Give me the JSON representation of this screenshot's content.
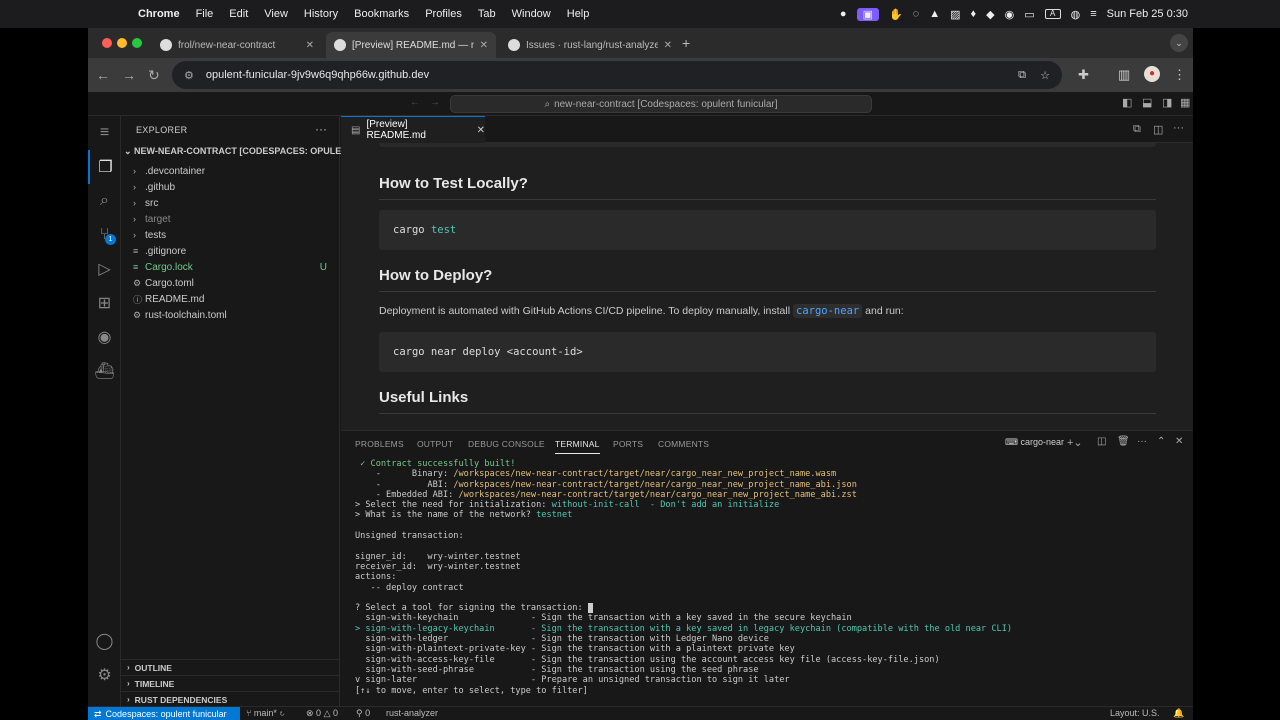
{
  "menubar": {
    "items": [
      "Chrome",
      "File",
      "Edit",
      "View",
      "History",
      "Bookmarks",
      "Profiles",
      "Tab",
      "Window",
      "Help"
    ],
    "datetime": "Sun Feb 25  0:30",
    "input_indicator": "A"
  },
  "browser": {
    "tabs": [
      {
        "label": "frol/new-near-contract"
      },
      {
        "label": "[Preview] README.md — new-near-contract"
      },
      {
        "label": "Issues · rust-lang/rust-analyzer"
      }
    ],
    "url": "opulent-funicular-9jv9w6q9qhp66w.github.dev"
  },
  "vscode": {
    "command_center": "new-near-contract [Codespaces: opulent funicular]",
    "explorer": {
      "title": "EXPLORER",
      "root": "NEW-NEAR-CONTRACT [CODESPACES: OPULE...",
      "items": [
        {
          "label": ".devcontainer",
          "type": "folder"
        },
        {
          "label": ".github",
          "type": "folder"
        },
        {
          "label": "src",
          "type": "folder"
        },
        {
          "label": "target",
          "type": "folder",
          "dim": true
        },
        {
          "label": "tests",
          "type": "folder"
        },
        {
          "label": ".gitignore",
          "type": "file"
        },
        {
          "label": "Cargo.lock",
          "type": "file",
          "status": "U"
        },
        {
          "label": "Cargo.toml",
          "type": "file"
        },
        {
          "label": "README.md",
          "type": "file"
        },
        {
          "label": "rust-toolchain.toml",
          "type": "file"
        }
      ],
      "sections": [
        "OUTLINE",
        "TIMELINE",
        "RUST DEPENDENCIES"
      ]
    },
    "editor_tab": "[Preview] README.md",
    "preview": {
      "heading_test": "How to Test Locally?",
      "code_test_cmd": "cargo",
      "code_test_arg": "test",
      "heading_deploy": "How to Deploy?",
      "deploy_text_before": "Deployment is automated with GitHub Actions CI/CD pipeline. To deploy manually, install",
      "deploy_code": "cargo-near",
      "deploy_text_after": "and run:",
      "code_deploy": "cargo near deploy <account-id>",
      "heading_links": "Useful Links"
    },
    "panel": {
      "tabs": [
        "PROBLEMS",
        "OUTPUT",
        "DEBUG CONSOLE",
        "TERMINAL",
        "PORTS",
        "COMMENTS"
      ],
      "active_tab": "TERMINAL",
      "terminal_name": "cargo-near",
      "terminal": {
        "built": " ✓ Contract successfully built!",
        "binary_label": "    -      Binary: ",
        "binary_path": "/workspaces/new-near-contract/target/near/cargo_near_new_project_name.wasm",
        "abi_label": "    -         ABI: ",
        "abi_path": "/workspaces/new-near-contract/target/near/cargo_near_new_project_name_abi.json",
        "emb_label": "    - Embedded ABI: ",
        "emb_path": "/workspaces/new-near-contract/target/near/cargo_near_new_project_name_abi.zst",
        "init_q": "> Select the need for initialization: ",
        "init_a": "without-init-call  - Don't add an initialize",
        "net_q": "> What is the name of the network? ",
        "net_a": "testnet",
        "unsigned": "Unsigned transaction:",
        "signer": "signer_id:    wry-winter.testnet",
        "receiver": "receiver_id:  wry-winter.testnet",
        "actions": "actions:",
        "deploy_action": "   -- deploy contract",
        "select_tool": "? Select a tool for signing the transaction: ",
        "options": [
          "  sign-with-keychain              - Sign the transaction with a key saved in the secure keychain",
          "> sign-with-legacy-keychain       - Sign the transaction with a key saved in legacy keychain (compatible with the old near CLI)",
          "  sign-with-ledger                - Sign the transaction with Ledger Nano device",
          "  sign-with-plaintext-private-key - Sign the transaction with a plaintext private key",
          "  sign-with-access-key-file       - Sign the transaction using the account access key file (access-key-file.json)",
          "  sign-with-seed-phrase           - Sign the transaction using the seed phrase",
          "v sign-later                      - Prepare an unsigned transaction to sign it later"
        ],
        "hint": "[↑↓ to move, enter to select, type to filter]"
      }
    },
    "status": {
      "remote": "Codespaces: opulent funicular",
      "branch": "main*",
      "problems": "0",
      "warnings": "0",
      "ports": "0",
      "analyzer": "rust-analyzer",
      "layout": "Layout: U.S."
    }
  }
}
